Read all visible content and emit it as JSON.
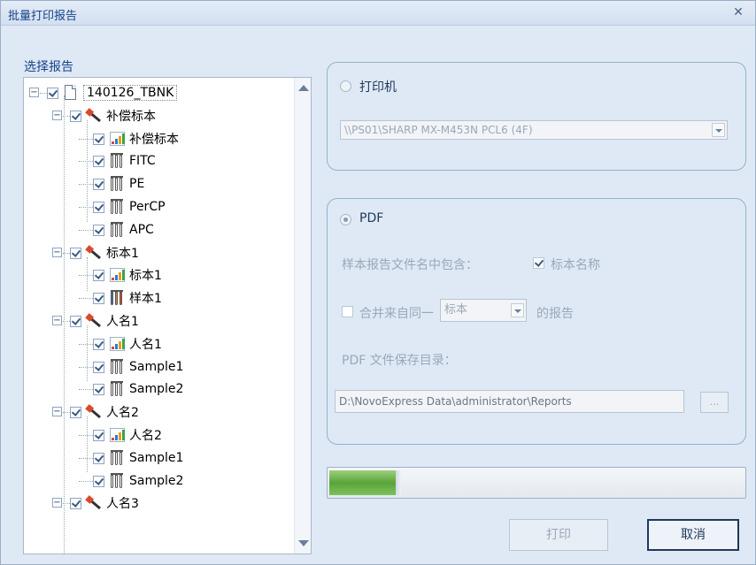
{
  "window": {
    "title": "批量打印报告",
    "close_glyph": "✕"
  },
  "select_label": "选择报告",
  "tree": {
    "root": "140126_TBNK",
    "groups": [
      {
        "label": "补偿标本",
        "items": [
          {
            "label": "补偿标本",
            "icon": "bar-chart-icon"
          },
          {
            "label": "FITC",
            "icon": "tubes-icon"
          },
          {
            "label": "PE",
            "icon": "tubes-icon"
          },
          {
            "label": "PerCP",
            "icon": "tubes-icon"
          },
          {
            "label": "APC",
            "icon": "tubes-icon"
          }
        ]
      },
      {
        "label": "标本1",
        "items": [
          {
            "label": "标本1",
            "icon": "bar-chart-icon"
          },
          {
            "label": "样本1",
            "icon": "tubes-icon"
          }
        ]
      },
      {
        "label": "人名1",
        "items": [
          {
            "label": "人名1",
            "icon": "bar-chart-icon"
          },
          {
            "label": "Sample1",
            "icon": "tubes-icon"
          },
          {
            "label": "Sample2",
            "icon": "tubes-icon"
          }
        ]
      },
      {
        "label": "人名2",
        "items": [
          {
            "label": "人名2",
            "icon": "bar-chart-icon"
          },
          {
            "label": "Sample1",
            "icon": "tubes-icon"
          },
          {
            "label": "Sample2",
            "icon": "tubes-icon"
          }
        ]
      },
      {
        "label": "人名3",
        "items": []
      }
    ]
  },
  "printer": {
    "radio_label": "打印机",
    "selected": "\\\\PS01\\SHARP MX-M453N PCL6 (4F)"
  },
  "pdf": {
    "radio_label": "PDF",
    "include_label": "样本报告文件名中包含：",
    "include_option": "标本名称",
    "merge_label": "合并来自同一",
    "merge_select": "标本",
    "merge_suffix": "的报告",
    "dir_label": "PDF 文件保存目录：",
    "dir_value": "D:\\NovoExpress Data\\administrator\\Reports",
    "browse_label": "..."
  },
  "progress": {
    "fraction": 0.16
  },
  "buttons": {
    "print": "打印",
    "cancel": "取消"
  },
  "colors": {
    "panel_border": "#8fb3c9",
    "progress_green": "#5ba43a",
    "title_text": "#15428b"
  }
}
